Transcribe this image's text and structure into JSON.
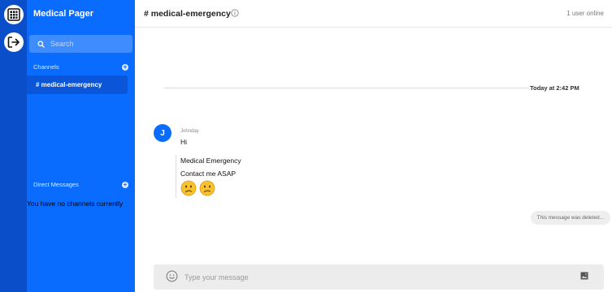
{
  "brand": {
    "title": "Medical Pager"
  },
  "search": {
    "placeholder": "Search"
  },
  "channels": {
    "label": "Channels",
    "active": "# medical-emergency"
  },
  "direct_messages": {
    "label": "Direct Messages",
    "empty_text": "You have no channels currently"
  },
  "header": {
    "room_title": "# medical-emergency",
    "online_status": "1 user online"
  },
  "feed": {
    "day_label": "Today at 2:42 PM",
    "avatar_initial": "J",
    "sender": "Johnday",
    "messages": [
      "Hi",
      "Medical Emergency",
      "Contact me ASAP"
    ],
    "reactions": [
      "worried-face-icon",
      "worried-face-icon"
    ],
    "deleted_notice": "This message was deleted..."
  },
  "composer": {
    "placeholder": "Type your message"
  },
  "colors": {
    "sidebar": "#0a6cff",
    "rail": "#0a4fc9",
    "active_channel": "#0a55d8",
    "accent": "#0a6cff"
  }
}
